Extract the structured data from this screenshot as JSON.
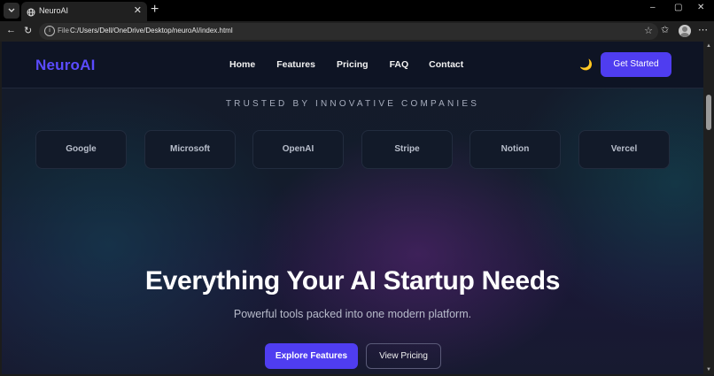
{
  "browser": {
    "tab_title": "NeuroAI",
    "url_prefix": "File",
    "url": "C:/Users/Dell/OneDrive/Desktop/neuroAI/index.html",
    "window_controls": [
      "–",
      "▢",
      "✕"
    ]
  },
  "site": {
    "brand": "NeuroAI",
    "nav": [
      "Home",
      "Features",
      "Pricing",
      "FAQ",
      "Contact"
    ],
    "theme_toggle_icon": "moon-icon",
    "cta": "Get Started",
    "trusted_heading": "TRUSTED BY INNOVATIVE COMPANIES",
    "companies": [
      "Google",
      "Microsoft",
      "OpenAI",
      "Stripe",
      "Notion",
      "Vercel"
    ],
    "hero_title": "Everything Your AI Startup Needs",
    "hero_subtitle": "Powerful tools packed into one modern platform.",
    "primary_button": "Explore Features",
    "secondary_button": "View Pricing"
  },
  "colors": {
    "accent": "#4f3df0",
    "brand": "#5b4bff",
    "background": "#131c2b"
  }
}
